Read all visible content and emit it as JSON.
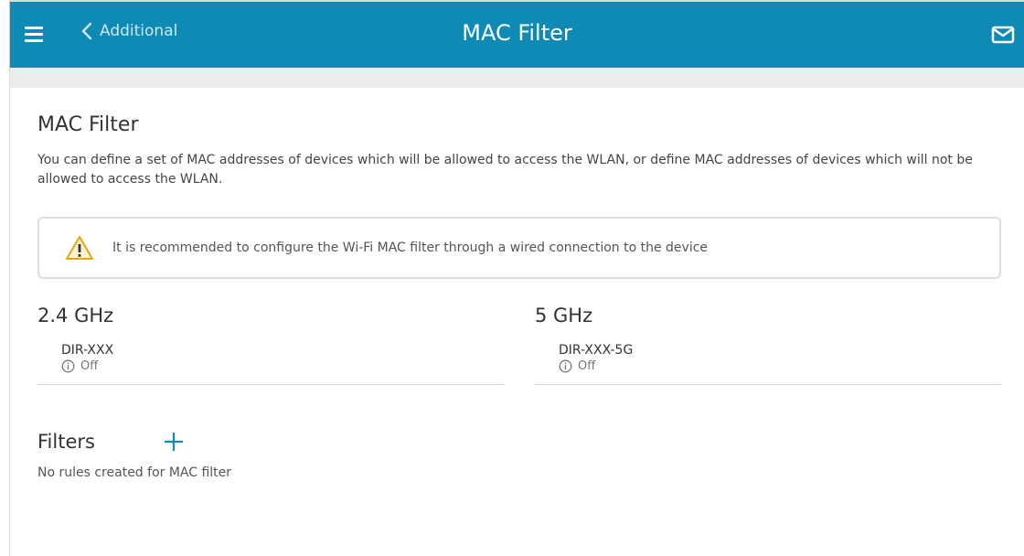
{
  "header": {
    "back_label": "Additional",
    "title": "MAC Filter",
    "bg_color": "#0e8ab4"
  },
  "icons": {
    "menu": "menu-icon",
    "back": "chevron-left-icon",
    "mail": "mail-icon",
    "warning": "warning-icon",
    "info": "info-icon",
    "add": "plus-icon"
  },
  "main": {
    "heading": "MAC Filter",
    "description": "You can define a set of MAC addresses of devices which will be allowed to access the WLAN, or define MAC addresses of devices which will not be allowed to access the WLAN.",
    "warning": "It is recommended to configure the Wi-Fi MAC filter through a wired connection to the device",
    "bands": [
      {
        "title": "2.4 GHz",
        "ssid": "DIR-XXX",
        "status": "Off"
      },
      {
        "title": "5 GHz",
        "ssid": "DIR-XXX-5G",
        "status": "Off"
      }
    ],
    "filters": {
      "title": "Filters",
      "empty_text": "No rules created for MAC filter"
    }
  }
}
